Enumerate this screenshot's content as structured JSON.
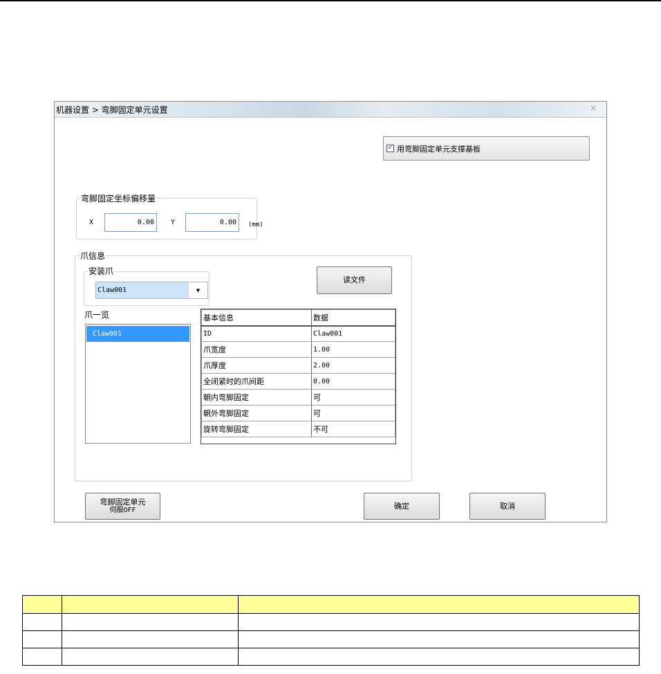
{
  "dialog": {
    "title": "机器设置 > 弯脚固定单元设置",
    "close_glyph": "×",
    "use_board_checkbox": {
      "label": "用弯脚固定单元支撑基板",
      "checked": true,
      "check_glyph": "✓"
    },
    "offset_group": {
      "label": "弯脚固定坐标偏移量",
      "x_label": "X",
      "x_value": "0.00",
      "y_label": "Y",
      "y_value": "0.00",
      "unit": "(mm)"
    },
    "claw_info": {
      "label": "爪信息",
      "install_label": "安装爪",
      "install_value": "Claw001",
      "dropdown_glyph": "▼",
      "read_file_button": "读文件",
      "list_label": "爪一览",
      "list_items": [
        "Claw001"
      ],
      "table_headers": [
        "基本信息",
        "数据"
      ],
      "table_rows": [
        [
          "ID",
          "Claw001"
        ],
        [
          "爪宽度",
          "1.00"
        ],
        [
          "爪厚度",
          "2.00"
        ],
        [
          "全闭紧时的爪间距",
          "0.00"
        ],
        [
          "朝内弯脚固定",
          "可"
        ],
        [
          "朝外弯脚固定",
          "可"
        ],
        [
          "旋转弯脚固定",
          "不可"
        ]
      ]
    },
    "servo_off_button": {
      "line1": "弯脚固定单元",
      "line2": "伺服OFF"
    },
    "ok_button": "确定",
    "cancel_button": "取消"
  }
}
